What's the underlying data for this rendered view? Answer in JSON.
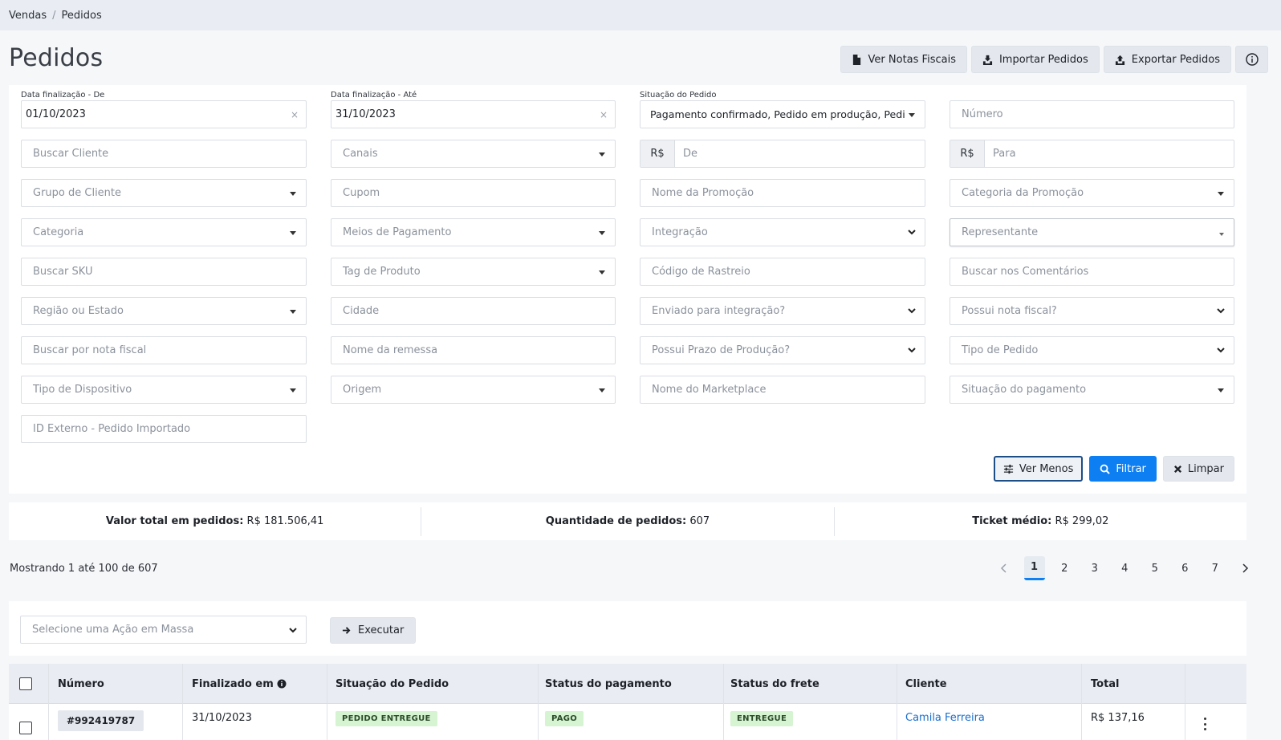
{
  "breadcrumb": {
    "items": [
      "Vendas",
      "Pedidos"
    ],
    "separator": "/"
  },
  "page": {
    "title": "Pedidos"
  },
  "top_actions": {
    "notas": "Ver Notas Fiscais",
    "importar": "Importar Pedidos",
    "exportar": "Exportar Pedidos"
  },
  "filters": {
    "date_from_label": "Data finalização - De",
    "date_from_value": "01/10/2023",
    "date_to_label": "Data finalização - Até",
    "date_to_value": "31/10/2023",
    "status_label": "Situação do Pedido",
    "status_value": "Pagamento confirmado, Pedido em produção, Pedido",
    "numero": "Número",
    "buscar_cliente": "Buscar Cliente",
    "canais": "Canais",
    "currency": "R$",
    "valor_de": "De",
    "valor_para": "Para",
    "grupo_cliente": "Grupo de Cliente",
    "cupom": "Cupom",
    "nome_promocao": "Nome da Promoção",
    "categoria_promocao": "Categoria da Promoção",
    "categoria": "Categoria",
    "meios_pagamento": "Meios de Pagamento",
    "integracao": "Integração",
    "representante": "Representante",
    "buscar_sku": "Buscar SKU",
    "tag_produto": "Tag de Produto",
    "codigo_rastreio": "Código de Rastreio",
    "buscar_comentarios": "Buscar nos Comentários",
    "regiao_estado": "Região ou Estado",
    "cidade": "Cidade",
    "enviado_integracao": "Enviado para integração?",
    "possui_nota": "Possui nota fiscal?",
    "buscar_nota": "Buscar por nota fiscal",
    "nome_remessa": "Nome da remessa",
    "prazo_producao": "Possui Prazo de Produção?",
    "tipo_pedido": "Tipo de Pedido",
    "tipo_dispositivo": "Tipo de Dispositivo",
    "origem": "Origem",
    "nome_marketplace": "Nome do Marketplace",
    "situacao_pagamento": "Situação do pagamento",
    "id_externo": "ID Externo - Pedido Importado",
    "clear_symbol": "×"
  },
  "filter_actions": {
    "ver_menos": "Ver Menos",
    "filtrar": "Filtrar",
    "limpar": "Limpar"
  },
  "summary": {
    "total_label": "Valor total em pedidos:",
    "total_value": "R$ 181.506,41",
    "qtd_label": "Quantidade de pedidos:",
    "qtd_value": "607",
    "ticket_label": "Ticket médio:",
    "ticket_value": "R$ 299,02"
  },
  "pagination": {
    "showing": "Mostrando 1 até 100 de 607",
    "pages": [
      "1",
      "2",
      "3",
      "4",
      "5",
      "6",
      "7"
    ],
    "active": "1"
  },
  "mass_action": {
    "placeholder": "Selecione uma Ação em Massa",
    "execute": "Executar"
  },
  "table": {
    "headers": {
      "numero": "Número",
      "finalizado": "Finalizado em",
      "situacao": "Situação do Pedido",
      "pagamento": "Status do pagamento",
      "frete": "Status do frete",
      "cliente": "Cliente",
      "total": "Total"
    },
    "rows": [
      {
        "numero": "#992419787",
        "finalizado": "31/10/2023",
        "situacao": "PEDIDO ENTREGUE",
        "pagamento": "PAGO",
        "frete": "ENTREGUE",
        "cliente": "Camila Ferreira",
        "total": "R$ 137,16"
      }
    ]
  },
  "colors": {
    "accent": "#0d7ff2",
    "badge_bg": "#d6f3d2",
    "link": "#1a6fcf",
    "header_bg": "#e9edf3"
  }
}
